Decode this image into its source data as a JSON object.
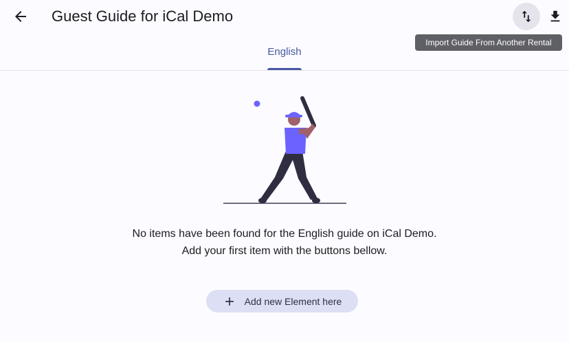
{
  "header": {
    "title": "Guest Guide for iCal Demo",
    "back_icon": "arrow-left-icon",
    "import_icon": "swap-vertical-icon",
    "download_icon": "download-icon"
  },
  "tooltip": {
    "text": "Import Guide From Another Rental"
  },
  "tabs": [
    {
      "label": "English",
      "selected": true
    }
  ],
  "empty_state": {
    "illustration": "baseball-player-illustration",
    "line1": "No items have been found for the English guide on iCal Demo.",
    "line2": "Add your first item with the buttons bellow."
  },
  "add_button": {
    "label": "Add new Element here",
    "icon": "plus-icon"
  },
  "colors": {
    "accent": "#4657a3",
    "illustration": "#6c63ff",
    "button_bg": "#dde0f4"
  }
}
